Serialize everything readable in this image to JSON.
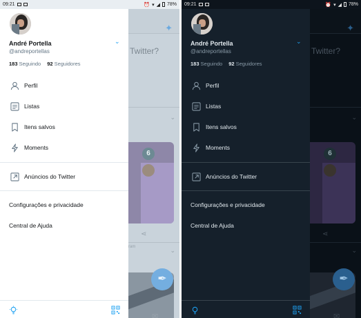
{
  "status_bar": {
    "time": "09:21",
    "battery": "78%"
  },
  "background": {
    "composer_fragment": "Twitter?",
    "media_badge": "6",
    "caption_fragment": "ram"
  },
  "profile": {
    "name": "André Portella",
    "handle": "@andreportellas",
    "following_count": "183",
    "following_label": "Seguindo",
    "followers_count": "92",
    "followers_label": "Seguidores"
  },
  "menu": {
    "items": [
      {
        "label": "Perfil",
        "icon": "person-icon"
      },
      {
        "label": "Listas",
        "icon": "list-icon"
      },
      {
        "label": "Itens salvos",
        "icon": "bookmark-icon"
      },
      {
        "label": "Moments",
        "icon": "lightning-icon"
      }
    ],
    "ads": {
      "label": "Anúncios do Twitter",
      "icon": "external-link-icon"
    },
    "settings": "Configurações e privacidade",
    "help": "Central de Ajuda"
  },
  "footer": {
    "left_icon": "bulb-icon",
    "right_icon": "qr-code-icon"
  },
  "themes": {
    "light": {
      "drawer_bg": "#ffffff",
      "text": "#14171a",
      "secondary": "#657786",
      "accent": "#1da1f2"
    },
    "dark": {
      "drawer_bg": "#15202b",
      "text": "#e1e8ed",
      "secondary": "#8899a6",
      "accent": "#1da1f2"
    }
  }
}
